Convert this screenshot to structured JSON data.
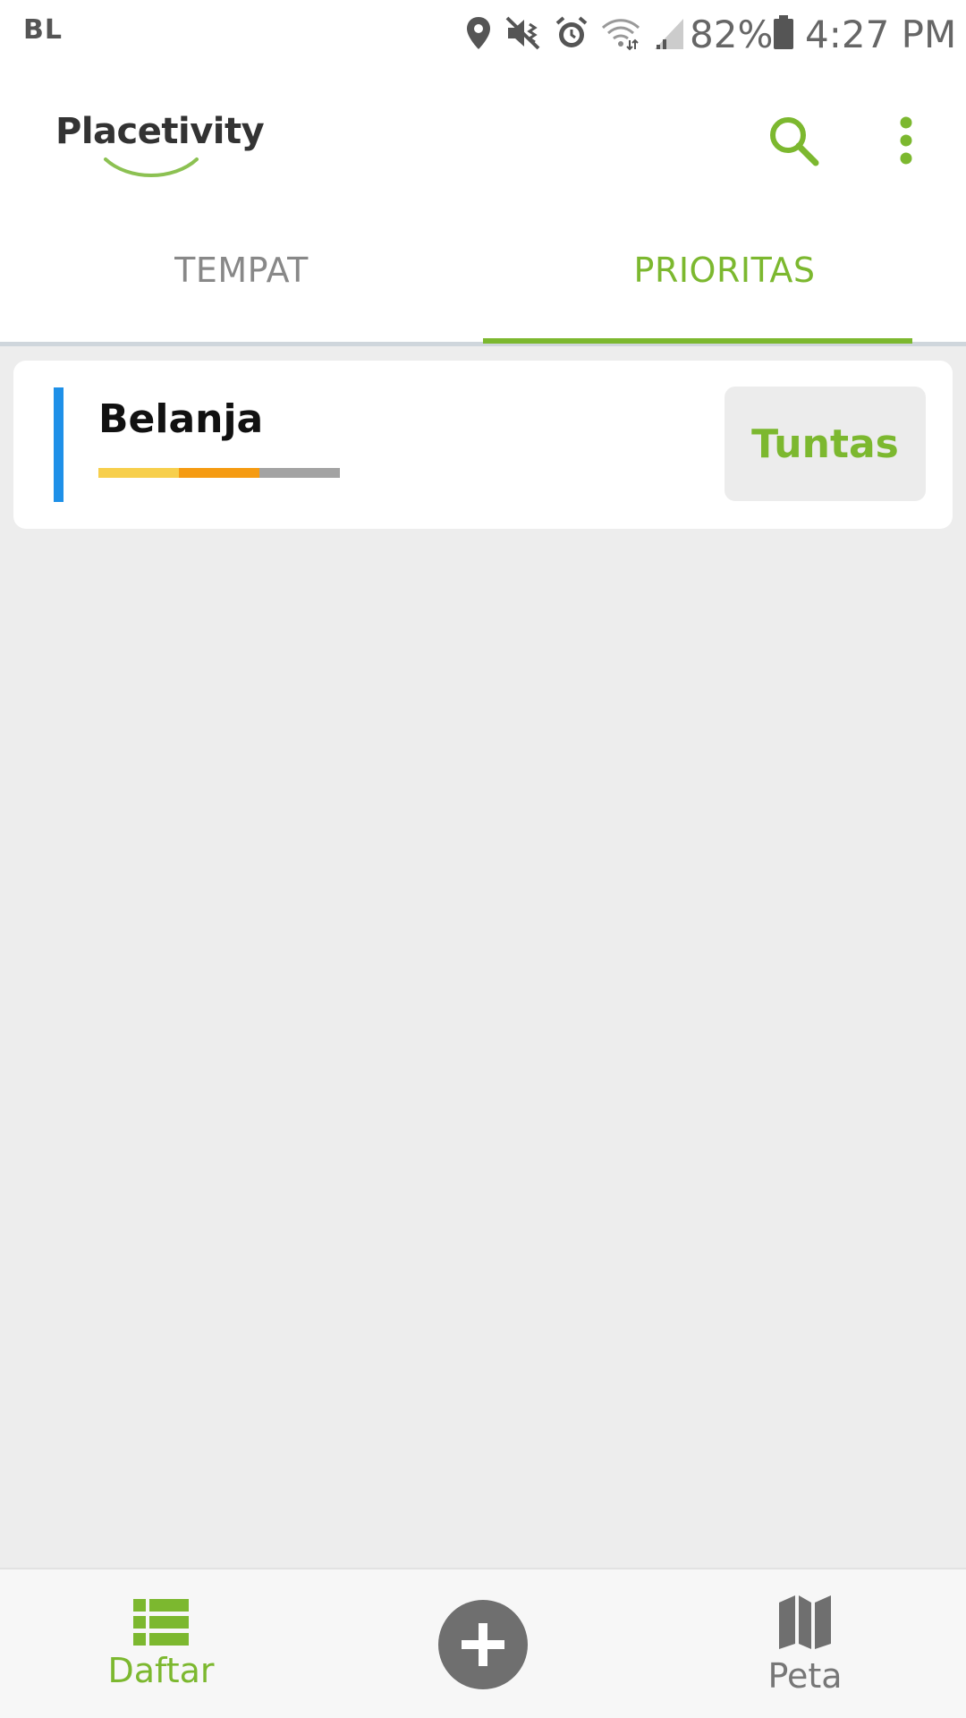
{
  "status_bar": {
    "carrier": "BL",
    "battery_percent": "82%",
    "time": "4:27 PM",
    "icons": [
      "location-icon",
      "mute-vibrate-icon",
      "alarm-icon",
      "wifi-icon",
      "signal-icon",
      "battery-icon"
    ]
  },
  "app_bar": {
    "logo_text": "Placetivity",
    "search_icon": "search-icon",
    "more_icon": "more-vert-icon"
  },
  "tabs": [
    {
      "label": "TEMPAT",
      "selected": false
    },
    {
      "label": "PRIORITAS",
      "selected": true
    }
  ],
  "list": {
    "items": [
      {
        "title": "Belanja",
        "accent_color": "#1e90e8",
        "priority_colors": [
          "#f7cf4c",
          "#f59b12",
          "#a3a3a3"
        ],
        "action_label": "Tuntas"
      }
    ]
  },
  "bottom_nav": {
    "daftar_label": "Daftar",
    "peta_label": "Peta",
    "add_icon": "add-icon"
  },
  "colors": {
    "accent_green": "#7cb82f",
    "background": "#ededed"
  }
}
